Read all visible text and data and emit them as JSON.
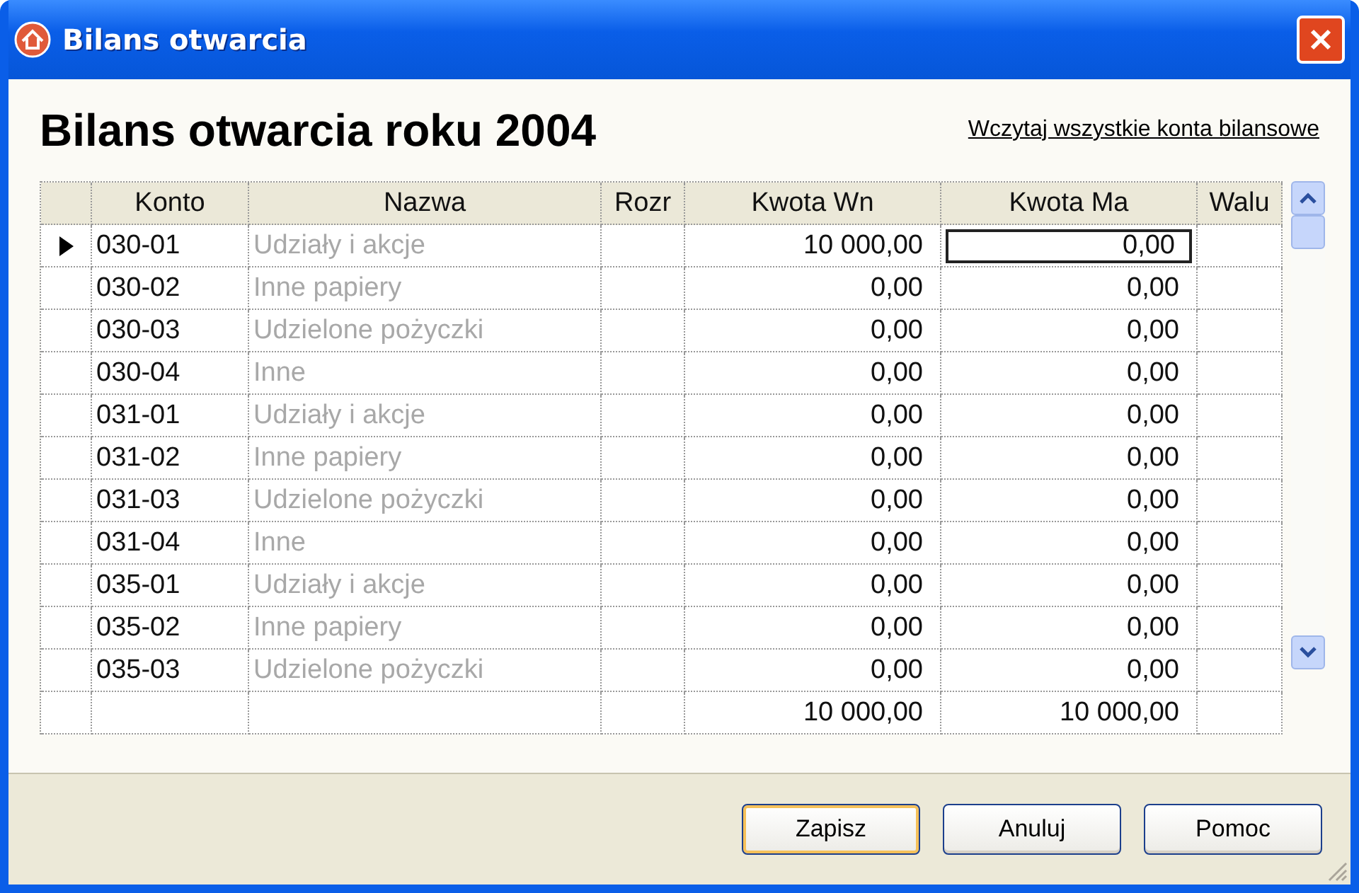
{
  "window": {
    "title": "Bilans otwarcia"
  },
  "heading": "Bilans otwarcia roku 2004",
  "load_link": "Wczytaj wszystkie konta bilansowe",
  "table": {
    "columns": [
      "Konto",
      "Nazwa",
      "Rozr",
      "Kwota Wn",
      "Kwota Ma",
      "Walu"
    ],
    "rows": [
      {
        "konto": "030-01",
        "nazwa": "Udziały i akcje",
        "wn": "10 000,00",
        "ma": "0,00",
        "selected": true
      },
      {
        "konto": "030-02",
        "nazwa": "Inne papiery",
        "wn": "0,00",
        "ma": "0,00",
        "selected": false
      },
      {
        "konto": "030-03",
        "nazwa": "Udzielone pożyczki",
        "wn": "0,00",
        "ma": "0,00",
        "selected": false
      },
      {
        "konto": "030-04",
        "nazwa": "Inne",
        "wn": "0,00",
        "ma": "0,00",
        "selected": false
      },
      {
        "konto": "031-01",
        "nazwa": "Udziały i akcje",
        "wn": "0,00",
        "ma": "0,00",
        "selected": false
      },
      {
        "konto": "031-02",
        "nazwa": "Inne papiery",
        "wn": "0,00",
        "ma": "0,00",
        "selected": false
      },
      {
        "konto": "031-03",
        "nazwa": "Udzielone pożyczki",
        "wn": "0,00",
        "ma": "0,00",
        "selected": false
      },
      {
        "konto": "031-04",
        "nazwa": "Inne",
        "wn": "0,00",
        "ma": "0,00",
        "selected": false
      },
      {
        "konto": "035-01",
        "nazwa": "Udziały i akcje",
        "wn": "0,00",
        "ma": "0,00",
        "selected": false
      },
      {
        "konto": "035-02",
        "nazwa": "Inne papiery",
        "wn": "0,00",
        "ma": "0,00",
        "selected": false
      },
      {
        "konto": "035-03",
        "nazwa": "Udzielone pożyczki",
        "wn": "0,00",
        "ma": "0,00",
        "selected": false
      }
    ],
    "totals": {
      "wn": "10 000,00",
      "ma": "10 000,00"
    }
  },
  "buttons": [
    {
      "label": "Zapisz",
      "default": true
    },
    {
      "label": "Anuluj",
      "default": false
    },
    {
      "label": "Pomoc",
      "default": false
    }
  ]
}
